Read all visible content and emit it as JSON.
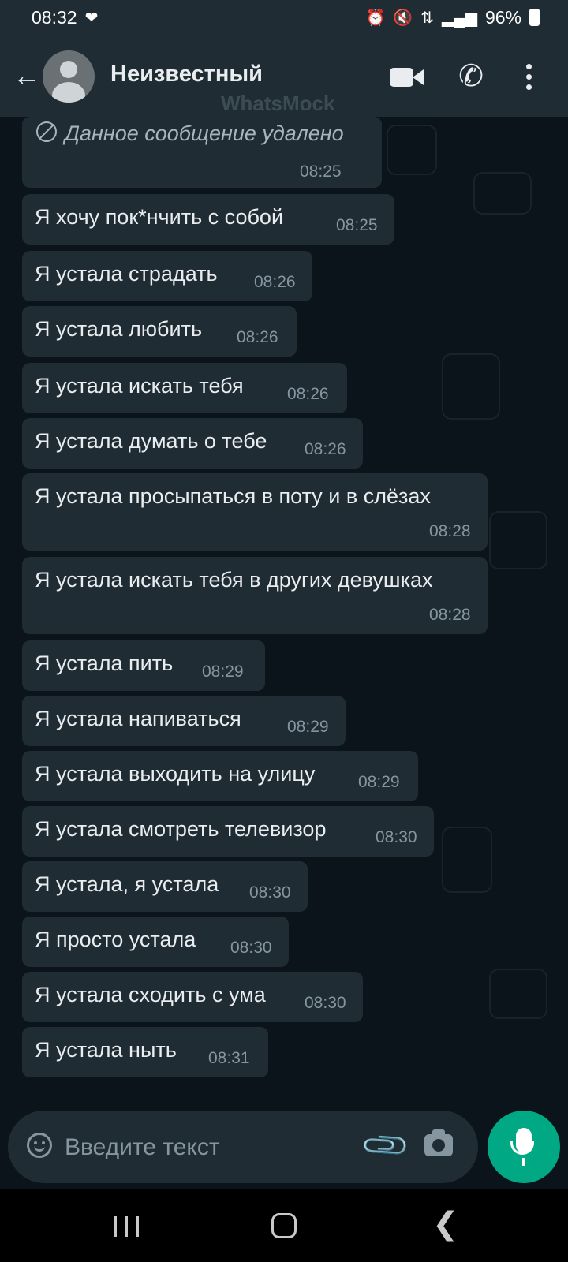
{
  "status_bar": {
    "time": "08:32",
    "heart_icon": "heart-icon",
    "battery": "96%"
  },
  "header": {
    "contact_name": "Неизвестный",
    "watermark": "WhatsMock",
    "icons": [
      "back-arrow-icon",
      "avatar",
      "video-call-icon",
      "phone-icon",
      "more-menu-icon"
    ]
  },
  "messages": [
    {
      "text": "Данное сообщение удалено",
      "time": "08:25",
      "deleted": true
    },
    {
      "text": "Я хочу пок*нчить с собой",
      "time": "08:25"
    },
    {
      "text": "Я устала страдать",
      "time": "08:26"
    },
    {
      "text": "Я устала любить",
      "time": "08:26"
    },
    {
      "text": "Я устала искать тебя",
      "time": "08:26"
    },
    {
      "text": "Я устала думать о тебе",
      "time": "08:26"
    },
    {
      "text": "Я устала просыпаться в поту и в слёзах",
      "time": "08:28"
    },
    {
      "text": "Я устала искать тебя в других девушках",
      "time": "08:28"
    },
    {
      "text": "Я устала пить",
      "time": "08:29"
    },
    {
      "text": "Я устала напиваться",
      "time": "08:29"
    },
    {
      "text": "Я устала выходить на улицу",
      "time": "08:29"
    },
    {
      "text": "Я устала смотреть телевизор",
      "time": "08:30"
    },
    {
      "text": "Я устала, я устала",
      "time": "08:30"
    },
    {
      "text": "Я просто устала",
      "time": "08:30"
    },
    {
      "text": "Я устала сходить с ума",
      "time": "08:30"
    },
    {
      "text": "Я устала ныть",
      "time": "08:31"
    }
  ],
  "composer": {
    "placeholder": "Введите текст"
  },
  "colors": {
    "background": "#0b141a",
    "bubble": "#1f2c34",
    "accent": "#00a884",
    "time": "#8696a0"
  }
}
